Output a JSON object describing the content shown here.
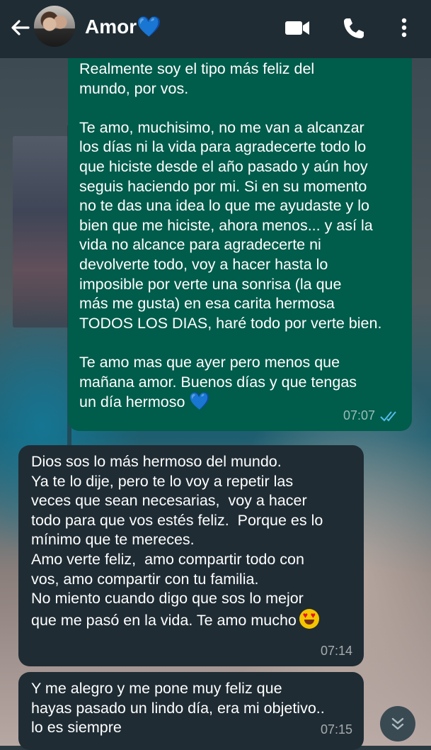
{
  "header": {
    "contact_name": "Amor",
    "name_emoji": "💙",
    "icons": [
      "back-arrow-icon",
      "avatar",
      "video-call-icon",
      "phone-icon",
      "menu-dots-icon"
    ]
  },
  "messages": [
    {
      "direction": "outgoing",
      "text": "Realmente soy el tipo más feliz del\nmundo, por vos.\n\nTe amo, muchisimo, no me van a alcanzar\nlos días ni la vida para agradecerte todo lo\nque hiciste desde el año pasado y aún hoy\nseguis haciendo por mi. Si en su momento\nno te das una idea lo que me ayudaste y lo\nbien que me hiciste, ahora menos... y así la\nvida no alcance para agradecerte ni\ndevolverte todo, voy a hacer hasta lo\nimposible por verte una sonrisa (la que\nmás me gusta) en esa carita hermosa\nTODOS LOS DIAS, haré todo por verte bien.\n\nTe amo mas que ayer pero menos que\nmañana amor. Buenos días y que tengas\nun día hermoso ",
      "emoji": "💙",
      "time": "07:07",
      "status": "read"
    },
    {
      "direction": "incoming",
      "text": "Dios sos lo más hermoso del mundo.\nYa te lo dije, pero te lo voy a repetir las\nveces que sean necesarias,  voy a hacer\ntodo para que vos estés feliz.  Porque es lo\nmínimo que te mereces.\nAmo verte feliz,  amo compartir todo con\nvos, amo compartir con tu familia.\nNo miento cuando digo que sos lo mejor\nque me pasó en la vida. Te amo mucho",
      "emoji": "😍",
      "time": "07:14"
    },
    {
      "direction": "incoming",
      "text": "Y me alegro y me pone muy feliz que\nhayas pasado un lindo día, era mi objetivo..\nlo es siempre",
      "time": "07:15"
    }
  ],
  "colors": {
    "header_bg": "#1f2c34",
    "outgoing_bg": "#005c4b",
    "incoming_bg": "#1f2c34",
    "read_ticks": "#53bdeb"
  }
}
